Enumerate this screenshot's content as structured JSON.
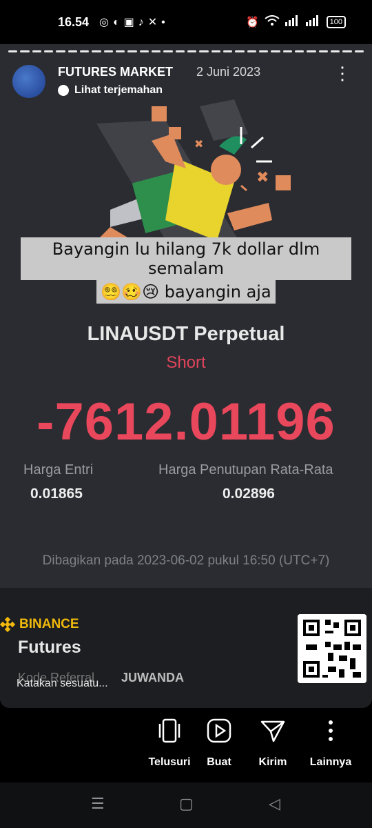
{
  "status_bar": {
    "time": "16.54",
    "app_icons": [
      "instagram-icon",
      "edge-icon",
      "shopee-icon",
      "tiktok-icon",
      "capcut-icon",
      "dot-icon"
    ],
    "battery": "100"
  },
  "post": {
    "author": "FUTURES MARKET",
    "date": "2 Juni 2023",
    "translate_label": "Lihat terjemahan",
    "caption_line1": "Bayangin lu hilang 7k dollar dlm semalam",
    "caption_line2": "😵‍💫🥴😢 bayangin aja"
  },
  "trade_card": {
    "pair": "LINAUSDT Perpetual",
    "side": "Short",
    "pnl": "-7612.01196",
    "entry_label": "Harga Entri",
    "entry_value": "0.01865",
    "close_label": "Harga Penutupan Rata-Rata",
    "close_value": "0.02896",
    "shared_on": "Dibagikan pada 2023-06-02 pukul 16:50 (UTC+7)",
    "brand": "BINANCE",
    "product": "Futures",
    "referral_label": "Kode Referral",
    "referral_code": "JUWANDA",
    "colors": {
      "loss": "#e9475b",
      "brand": "#f0b90b"
    }
  },
  "reply_placeholder": "Katakan sesuatu...",
  "actions": [
    {
      "label": "Telusuri",
      "icon": "browse-icon"
    },
    {
      "label": "Buat",
      "icon": "play-icon"
    },
    {
      "label": "Kirim",
      "icon": "send-icon"
    },
    {
      "label": "Lainnya",
      "icon": "more-icon"
    }
  ],
  "nav": [
    "menu-icon",
    "home-icon",
    "back-icon"
  ]
}
